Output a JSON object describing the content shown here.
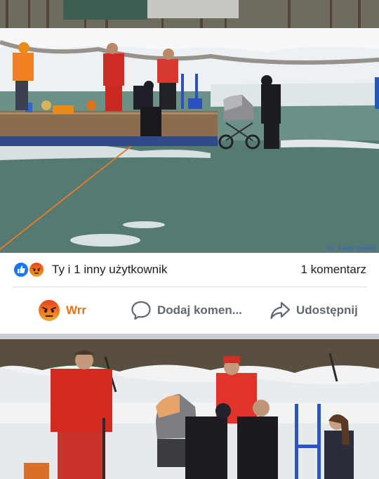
{
  "post": {
    "photo_credit": "fot.: Paweł Deptuch",
    "reactions": {
      "icons": [
        "like-icon",
        "angry-icon"
      ],
      "summary": "Ty i 1 inny użytkownik",
      "comments": "1 komentarz"
    },
    "actions": {
      "reaction_label": "Wrr",
      "comment_label": "Dodaj komen...",
      "share_label": "Udostępnij"
    }
  },
  "colors": {
    "like_blue": "#1877f2",
    "wrr_orange": "#e9710f",
    "action_grey": "#606770",
    "separator": "#c9ccd1"
  }
}
